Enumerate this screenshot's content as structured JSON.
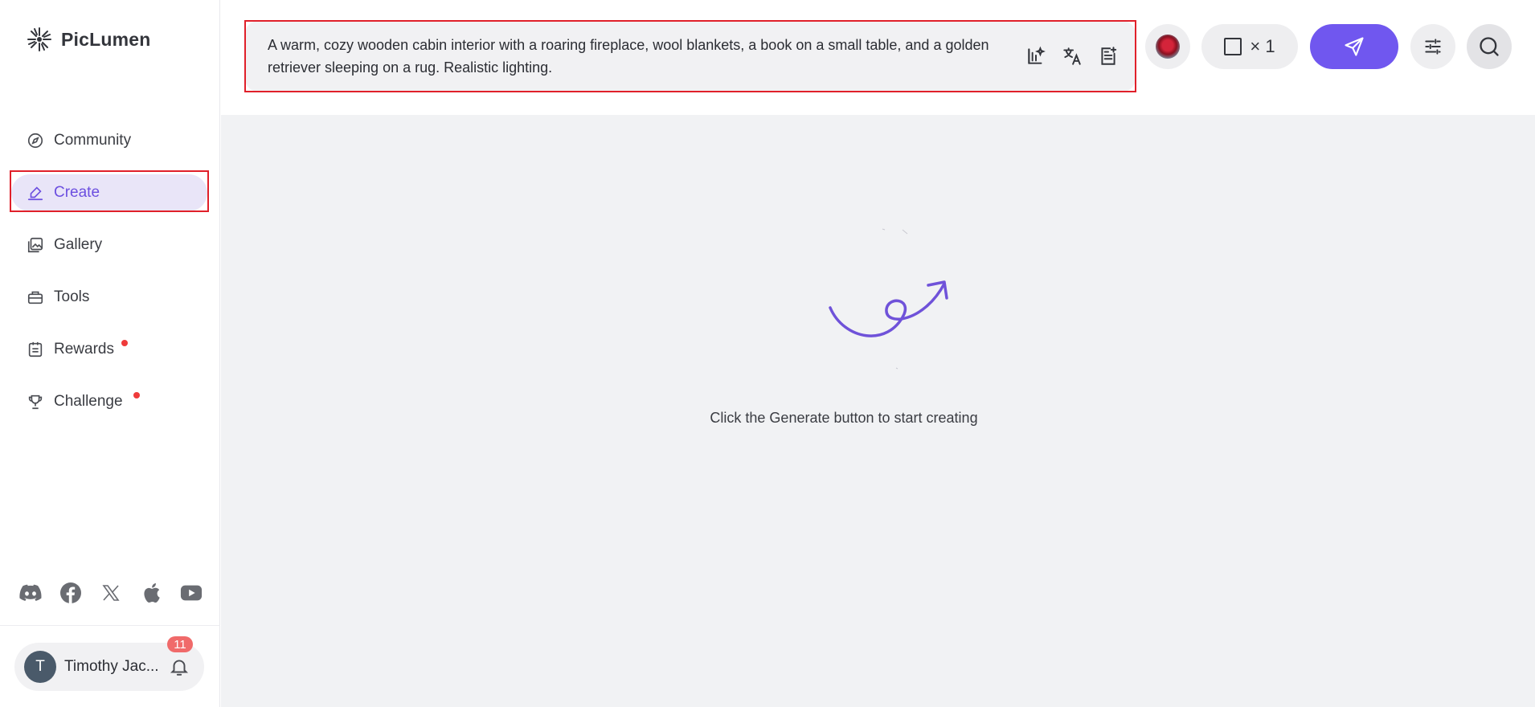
{
  "brand": {
    "name": "PicLumen"
  },
  "sidebar": {
    "items": [
      {
        "label": "Community",
        "icon": "compass-icon",
        "active": false,
        "dot": false
      },
      {
        "label": "Create",
        "icon": "pen-icon",
        "active": true,
        "dot": false
      },
      {
        "label": "Gallery",
        "icon": "gallery-icon",
        "active": false,
        "dot": false
      },
      {
        "label": "Tools",
        "icon": "toolbox-icon",
        "active": false,
        "dot": false
      },
      {
        "label": "Rewards",
        "icon": "clipboard-icon",
        "active": false,
        "dot": true
      },
      {
        "label": "Challenge",
        "icon": "trophy-icon",
        "active": false,
        "dot": true
      }
    ],
    "socials": [
      "discord-icon",
      "facebook-icon",
      "x-icon",
      "apple-icon",
      "youtube-icon"
    ]
  },
  "user": {
    "initial": "T",
    "name": "Timothy Jac...",
    "notifications": "11"
  },
  "prompt": {
    "text": "A warm, cozy wooden cabin interior with a roaring fireplace, wool blankets, a book on a small table, and a golden retriever sleeping on a rug. Realistic lighting.",
    "tools": [
      "prompt-enhance-icon",
      "translate-icon",
      "prompt-template-icon"
    ]
  },
  "toolbar": {
    "batch_count": "× 1"
  },
  "main": {
    "empty_message": "Click the Generate button to start creating"
  },
  "colors": {
    "accent": "#7057ef",
    "active_bg": "#e9e5f8",
    "notification_dot": "#ef3b3b",
    "canvas_bg": "#f1f2f4"
  }
}
